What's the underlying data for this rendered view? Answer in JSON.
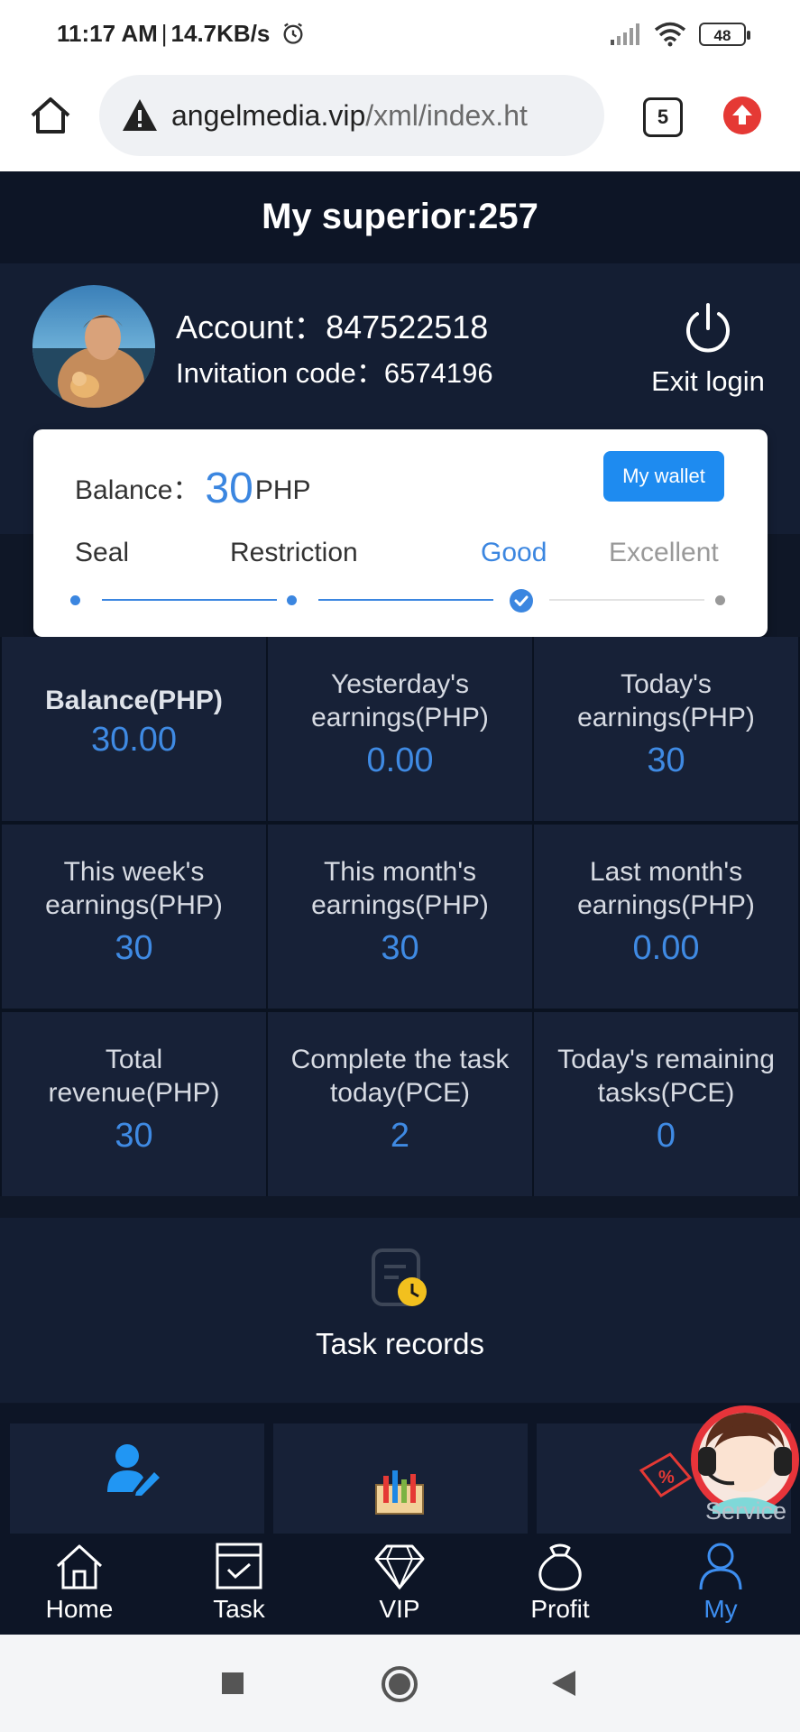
{
  "status_bar": {
    "time": "11:17 AM",
    "speed": "14.7KB/s",
    "battery": "48"
  },
  "browser": {
    "url_host": "angelmedia.vip",
    "url_path": "/xml/index.ht",
    "tab_count": "5"
  },
  "header": {
    "superior": "My superior:257"
  },
  "profile": {
    "account_label": "Account：",
    "account_value": "847522518",
    "invite_label": "Invitation code：",
    "invite_value": "6574196",
    "exit_label": "Exit login"
  },
  "balance_card": {
    "label": "Balance：",
    "value": "30",
    "unit": "PHP",
    "wallet_button": "My wallet",
    "levels": [
      "Seal",
      "Restriction",
      "Good",
      "Excellent"
    ],
    "current_level": "Good"
  },
  "stats": [
    {
      "label": "Balance(PHP)",
      "value": "30.00"
    },
    {
      "label": "Yesterday's earnings(PHP)",
      "value": "0.00"
    },
    {
      "label": "Today's earnings(PHP)",
      "value": "30"
    },
    {
      "label": "This week's earnings(PHP)",
      "value": "30"
    },
    {
      "label": "This month's earnings(PHP)",
      "value": "30"
    },
    {
      "label": "Last month's earnings(PHP)",
      "value": "0.00"
    },
    {
      "label": "Total revenue(PHP)",
      "value": "30"
    },
    {
      "label": "Complete the task today(PCE)",
      "value": "2"
    },
    {
      "label": "Today's remaining tasks(PCE)",
      "value": "0"
    }
  ],
  "task_records": {
    "label": "Task records"
  },
  "service": {
    "label": "Service"
  },
  "nav": {
    "items": [
      "Home",
      "Task",
      "VIP",
      "Profit",
      "My"
    ],
    "active": "My"
  },
  "colors": {
    "accent": "#3d8ef0",
    "background": "#0f1727",
    "card": "#ffffff"
  }
}
